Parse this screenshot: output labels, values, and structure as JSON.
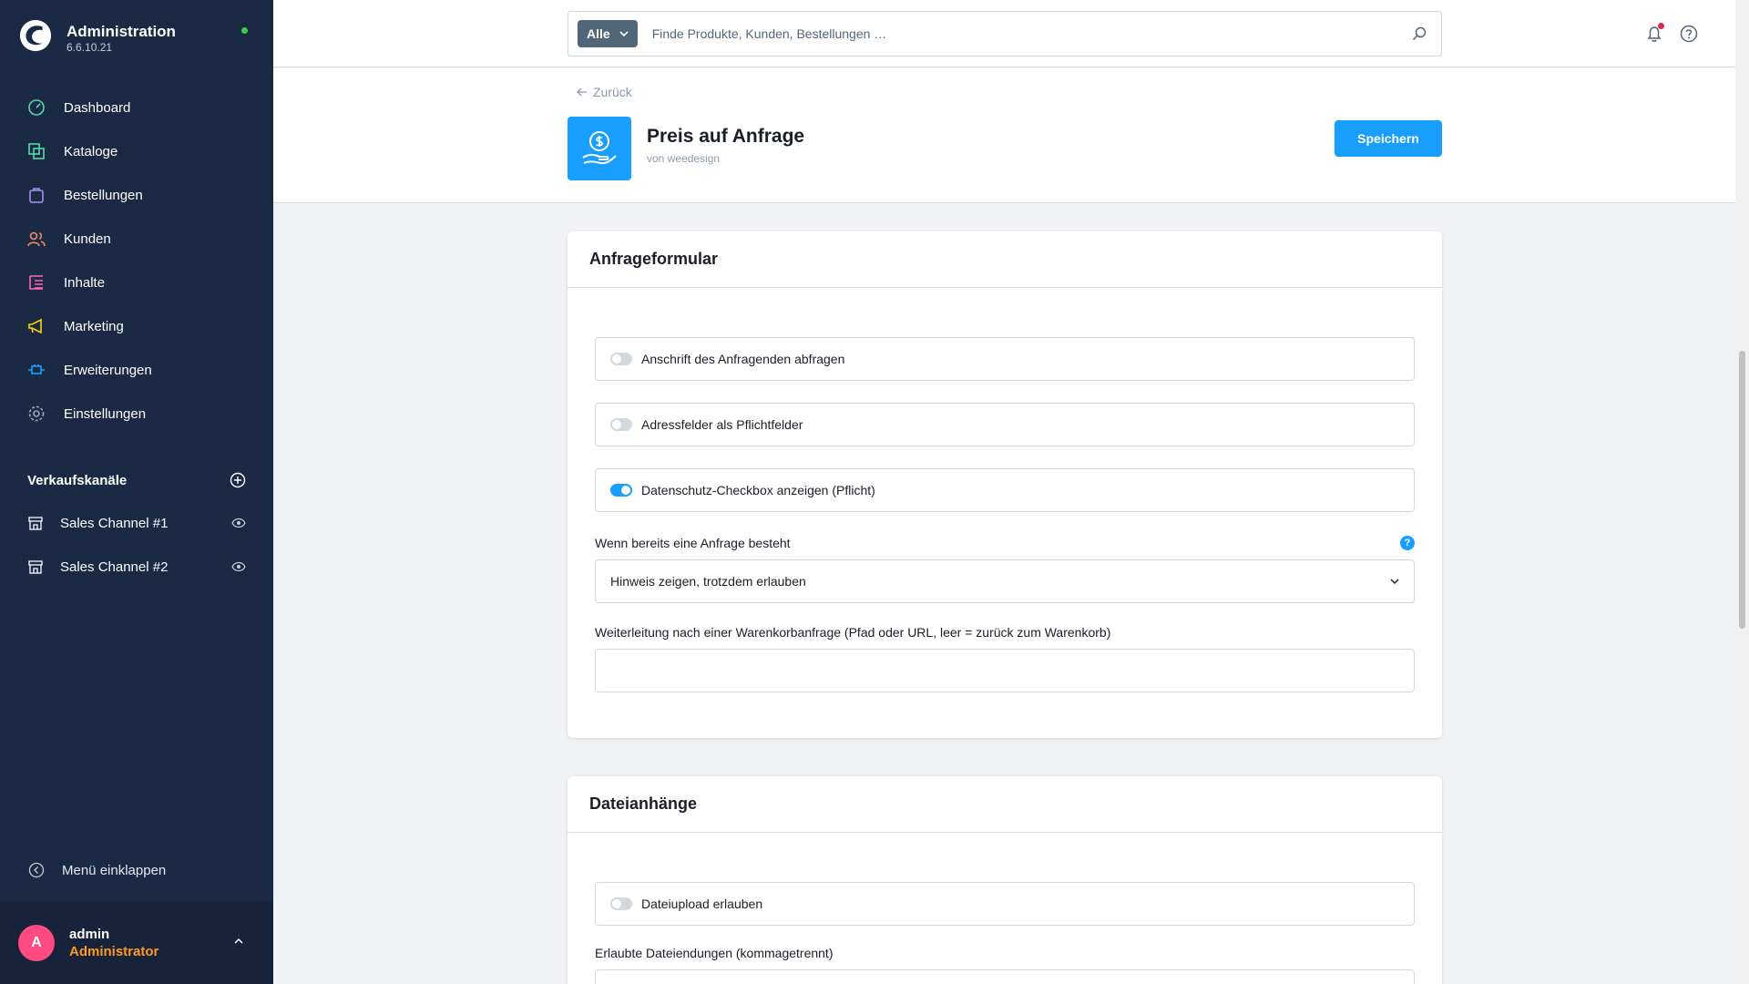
{
  "app": {
    "title": "Administration",
    "version": "6.6.10.21"
  },
  "sidebar": {
    "items": [
      {
        "label": "Dashboard",
        "icon": "dashboard-icon",
        "color": "#57d9a3"
      },
      {
        "label": "Kataloge",
        "icon": "catalog-icon",
        "color": "#57d9a3"
      },
      {
        "label": "Bestellungen",
        "icon": "orders-icon",
        "color": "#a092f0"
      },
      {
        "label": "Kunden",
        "icon": "customers-icon",
        "color": "#f88962"
      },
      {
        "label": "Inhalte",
        "icon": "content-icon",
        "color": "#ff68b4"
      },
      {
        "label": "Marketing",
        "icon": "marketing-icon",
        "color": "#ffd700"
      },
      {
        "label": "Erweiterungen",
        "icon": "extensions-icon",
        "color": "#189eff"
      },
      {
        "label": "Einstellungen",
        "icon": "settings-icon",
        "color": "#9aa8b5"
      }
    ],
    "sales_channels": {
      "title": "Verkaufskanäle",
      "items": [
        {
          "label": "Sales Channel #1"
        },
        {
          "label": "Sales Channel #2"
        }
      ]
    },
    "collapse_label": "Menü einklappen",
    "user": {
      "initial": "A",
      "name": "admin",
      "role": "Administrator"
    }
  },
  "search": {
    "type_label": "Alle",
    "placeholder": "Finde Produkte, Kunden, Bestellungen …"
  },
  "header": {
    "back_label": "Zurück",
    "plugin_title": "Preis auf Anfrage",
    "plugin_subtitle": "von weedesign",
    "save_label": "Speichern"
  },
  "cards": {
    "form": {
      "title": "Anfrageformular",
      "toggles": [
        {
          "label": "Anschrift des Anfragenden abfragen",
          "on": false
        },
        {
          "label": "Adressfelder als Pflichtfelder",
          "on": false
        },
        {
          "label": "Datenschutz-Checkbox anzeigen (Pflicht)",
          "on": true
        }
      ],
      "existing_request_label": "Wenn bereits eine Anfrage besteht",
      "existing_request_value": "Hinweis zeigen, trotzdem erlauben",
      "redirect_label": "Weiterleitung nach einer Warenkorbanfrage (Pfad oder URL, leer = zurück zum Warenkorb)",
      "redirect_value": ""
    },
    "attachments": {
      "title": "Dateianhänge",
      "upload_label": "Dateiupload erlauben",
      "upload_on": false,
      "extensions_label": "Erlaubte Dateiendungen (kommagetrennt)"
    }
  },
  "colors": {
    "sidebar_bg": "#1b2a44",
    "accent": "#189eff",
    "role": "#ff9a1f",
    "avatar": "#ff4b82",
    "status": "#37d046"
  }
}
